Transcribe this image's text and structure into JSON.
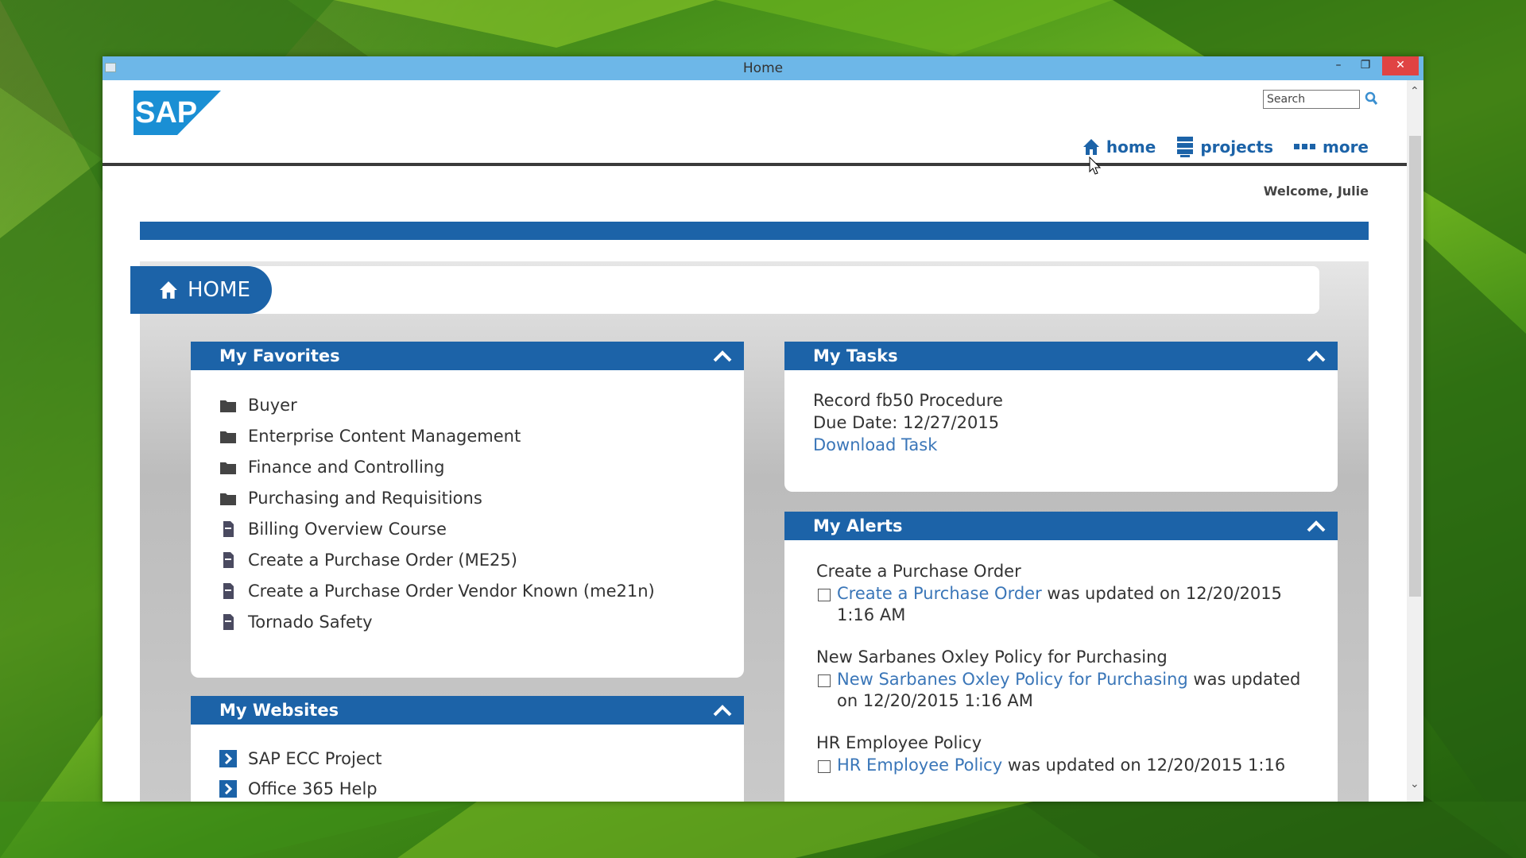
{
  "window": {
    "title": "Home"
  },
  "header": {
    "search_placeholder": "Search",
    "nav": [
      {
        "label": "home",
        "icon": "home-icon"
      },
      {
        "label": "projects",
        "icon": "projects-icon"
      },
      {
        "label": "more",
        "icon": "more-dots-icon"
      }
    ],
    "welcome": "Welcome, Julie",
    "logo_text": "SAP"
  },
  "page": {
    "home_tab": "HOME"
  },
  "favorites": {
    "title": "My Favorites",
    "items": [
      {
        "label": "Buyer",
        "icon": "folder-icon"
      },
      {
        "label": "Enterprise Content Management",
        "icon": "folder-icon"
      },
      {
        "label": "Finance and Controlling",
        "icon": "folder-icon"
      },
      {
        "label": "Purchasing and Requisitions",
        "icon": "folder-icon"
      },
      {
        "label": "Billing Overview Course",
        "icon": "document-icon"
      },
      {
        "label": "Create a Purchase Order (ME25)",
        "icon": "document-icon"
      },
      {
        "label": "Create a Purchase Order Vendor Known (me21n)",
        "icon": "document-icon"
      },
      {
        "label": "Tornado Safety",
        "icon": "document-icon"
      }
    ]
  },
  "websites": {
    "title": "My Websites",
    "items": [
      {
        "label": "SAP ECC Project",
        "icon": "arrow-link-icon"
      },
      {
        "label": "Office 365 Help",
        "icon": "arrow-link-icon"
      }
    ]
  },
  "tasks": {
    "title": "My Tasks",
    "task_name": "Record fb50 Procedure",
    "due_date": "Due Date: 12/27/2015",
    "download_label": "Download Task"
  },
  "alerts": {
    "title": "My Alerts",
    "items": [
      {
        "title": "Create a Purchase Order",
        "link": "Create a Purchase Order",
        "text_after": " was updated on 12/20/2015 1:16 AM"
      },
      {
        "title": "New Sarbanes Oxley Policy for Purchasing",
        "link": "New Sarbanes Oxley Policy for Purchasing",
        "text_after": " was updated on 12/20/2015 1:16 AM"
      },
      {
        "title": "HR Employee Policy",
        "link": "HR Employee Policy",
        "text_after": " was updated on 12/20/2015 1:16"
      }
    ]
  },
  "colors": {
    "brand_blue": "#1c63a8",
    "link_blue": "#3a76b8",
    "titlebar": "#6db7e8",
    "close_red": "#e04343"
  }
}
